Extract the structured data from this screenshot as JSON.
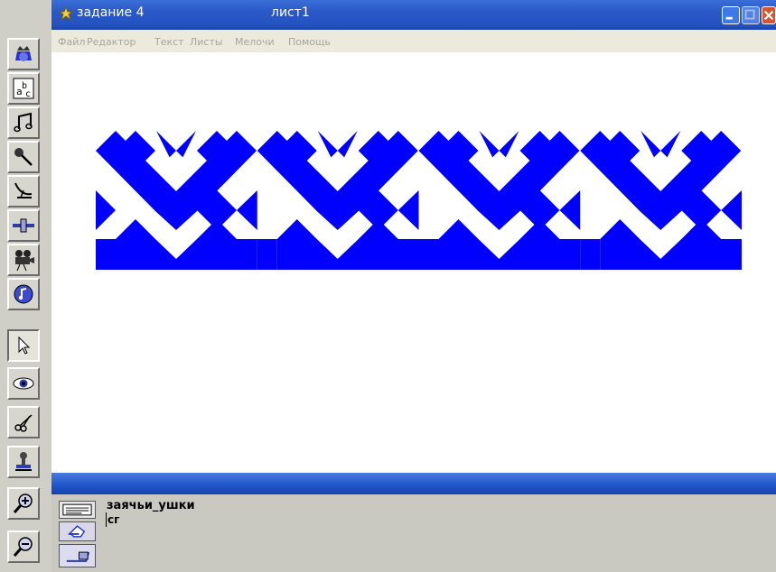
{
  "window": {
    "title": "задание 4",
    "sheet": "лист1"
  },
  "menu": {
    "items": [
      "Файл",
      "Редактор",
      "Текст",
      "Листы",
      "Мелочи",
      "Помощь"
    ]
  },
  "toolbar": {
    "tools": [
      "stamp-chooser-icon",
      "text-tool-icon",
      "music-icon",
      "microphone-icon",
      "satellite-dish-icon",
      "slider-tool-icon",
      "movie-camera-icon",
      "note-circle-icon",
      "arrow-pointer-icon",
      "eye-icon",
      "scissors-icon",
      "rubber-stamp-icon",
      "zoom-in-icon",
      "zoom-out-icon"
    ]
  },
  "canvas": {
    "ornament_name": "hare ears ornament",
    "colors": {
      "blue": "#0000ff",
      "white": "#ffffff"
    }
  },
  "bottom": {
    "name": "заячьи_ушки",
    "text": "сг"
  },
  "colors": {
    "title_bar": "#2452c0",
    "ornament": "#0000ff"
  }
}
